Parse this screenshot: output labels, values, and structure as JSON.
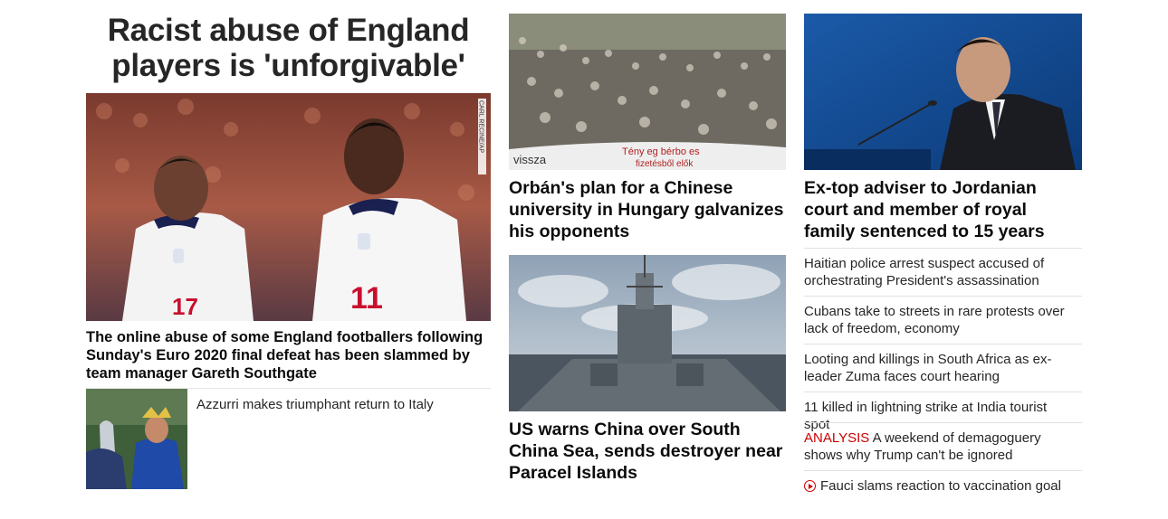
{
  "hero": {
    "title": "Racist abuse of England players is 'unforgivable'",
    "caption": "The online abuse of some England footballers following Sunday's Euro 2020 final defeat has been slammed by team manager Gareth Southgate",
    "photo_credit": "CARL RECINE/AP",
    "image_icon": "photo-icon"
  },
  "azzurri": {
    "text": "Azzurri makes triumphant return to Italy"
  },
  "col2": {
    "story1": "Orbán's plan for a Chinese university in Hungary galvanizes his opponents",
    "banner_text1": "Tény eg bérbo es",
    "banner_text2": "vissza",
    "banner_text3": "fizetésből elők",
    "story2": "US warns China over South China Sea, sends destroyer near Paracel Islands"
  },
  "col3": {
    "headline": "Ex-top adviser to Jordanian court and member of royal family sentenced to 15 years",
    "items": [
      {
        "text": "Haitian police arrest suspect accused of orchestrating President's assassination"
      },
      {
        "text": "Cubans take to streets in rare protests over lack of freedom, economy"
      },
      {
        "text": "Looting and killings in South Africa as ex-leader Zuma faces court hearing"
      },
      {
        "text": "11 killed in lightning strike at India tourist spot"
      },
      {
        "label": "ANALYSIS",
        "text": " A weekend of demagoguery shows why Trump can't be ignored"
      },
      {
        "text": "Fauci slams reaction to vaccination goal",
        "icon": "play-icon"
      }
    ]
  },
  "colors": {
    "accent_red": "#cc0000",
    "text_dark": "#0c0c0c",
    "divider": "#e1e1e1"
  }
}
